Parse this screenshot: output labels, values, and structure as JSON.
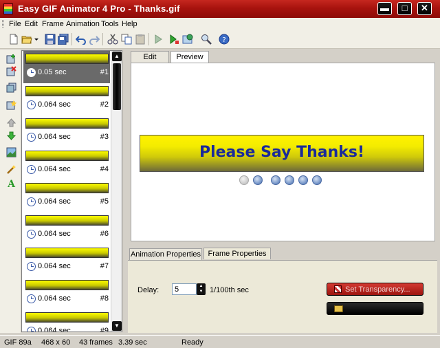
{
  "window": {
    "title": "Easy GIF Animator 4 Pro - Thanks.gif",
    "minimize": "▬",
    "maximize": "□",
    "close": "✕"
  },
  "menu": [
    "File",
    "Edit",
    "Frame",
    "Animation",
    "Tools",
    "Help"
  ],
  "toolbar_icons": [
    "new-icon",
    "open-icon",
    "dropdown-arrow-icon",
    "save-icon",
    "save-all-icon",
    "undo-icon",
    "redo-icon",
    "cut-icon",
    "copy-icon",
    "paste-icon",
    "play-icon",
    "preview-icon",
    "web-icon",
    "zoom-icon",
    "help-icon"
  ],
  "vertical_tools": [
    "add-frame-icon",
    "delete-frame-icon",
    "duplicate-frame-icon",
    "insert-frame-icon",
    "move-up-icon",
    "move-down-icon",
    "edit-image-icon",
    "wand-icon",
    "text-icon"
  ],
  "frames": [
    {
      "delay": "0.05 sec",
      "num": "#1",
      "selected": true
    },
    {
      "delay": "0.064 sec",
      "num": "#2"
    },
    {
      "delay": "0.064 sec",
      "num": "#3"
    },
    {
      "delay": "0.064 sec",
      "num": "#4"
    },
    {
      "delay": "0.064 sec",
      "num": "#5"
    },
    {
      "delay": "0.064 sec",
      "num": "#6"
    },
    {
      "delay": "0.064 sec",
      "num": "#7"
    },
    {
      "delay": "0.064 sec",
      "num": "#8"
    },
    {
      "delay": "0.064 sec",
      "num": "#9"
    }
  ],
  "editor_tabs": {
    "edit": "Edit",
    "preview": "Preview"
  },
  "preview": {
    "banner_text": "Please Say Thanks!"
  },
  "playback_controls": [
    "stop-icon",
    "play-icon",
    "first-frame-icon",
    "prev-frame-icon",
    "next-frame-icon",
    "last-frame-icon"
  ],
  "props_tabs": {
    "animation": "Animation Properties",
    "frame": "Frame Properties"
  },
  "frame_props": {
    "delay_label": "Delay:",
    "delay_value": "5",
    "delay_unit": "1/100th sec",
    "transparency_button": "Set Transparency..."
  },
  "status": {
    "format": "GIF 89a",
    "size": "468 x 60",
    "frames": "43 frames",
    "duration": "3.39 sec",
    "state": "Ready"
  },
  "colors": {
    "titlebar": "#a8130e",
    "banner_text": "#1a2a9a",
    "banner_yellow": "#fff200"
  }
}
